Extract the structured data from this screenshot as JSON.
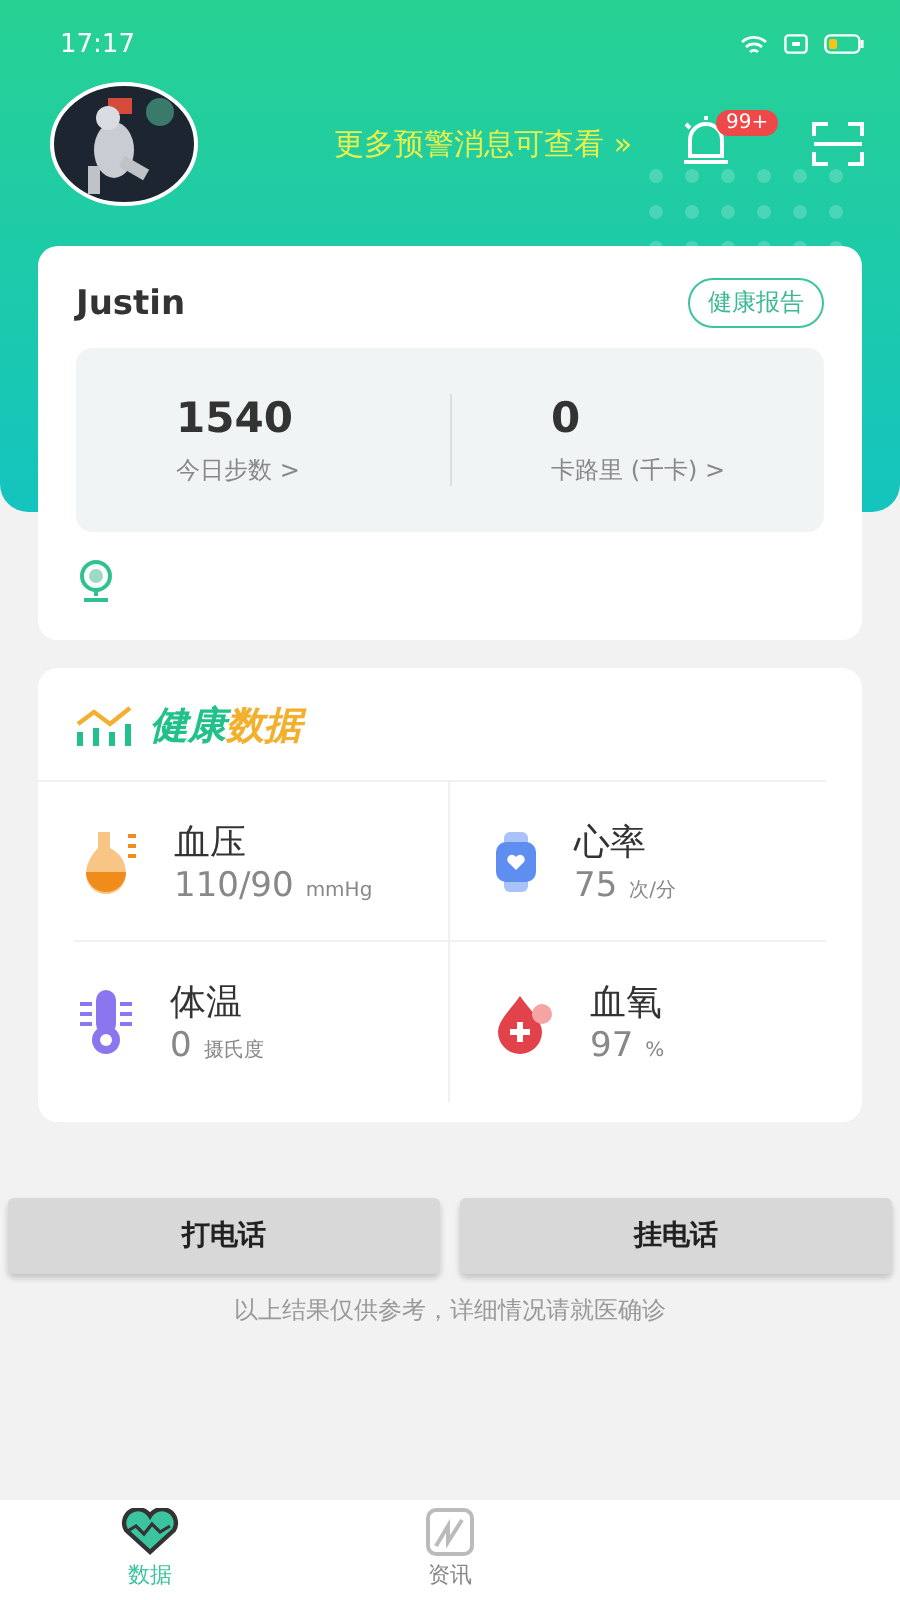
{
  "status_bar": {
    "time": "17:17"
  },
  "header": {
    "alert_link": "更多预警消息可查看 »",
    "badge": "99+"
  },
  "profile": {
    "name": "Justin",
    "report_button": "健康报告",
    "stats": [
      {
        "value": "1540",
        "label": "今日步数 >"
      },
      {
        "value": "0",
        "label": "卡路里 (千卡) >"
      }
    ]
  },
  "health": {
    "title_lead": "健康",
    "title_tail": "数据",
    "metrics": [
      {
        "kind": "pressure",
        "name": "血压",
        "value": "110/90",
        "unit": "mmHg"
      },
      {
        "kind": "heart",
        "name": "心率",
        "value": "75",
        "unit": "次/分"
      },
      {
        "kind": "temperature",
        "name": "体温",
        "value": "0",
        "unit": "摄氏度"
      },
      {
        "kind": "oxygen",
        "name": "血氧",
        "value": "97",
        "unit": "%"
      }
    ]
  },
  "buttons": [
    "打电话",
    "挂电话"
  ],
  "disclaimer": "以上结果仅供参考，详细情况请就医确诊",
  "tabs": [
    {
      "label": "数据",
      "kind": "heart",
      "selected": true
    },
    {
      "label": "资讯",
      "kind": "news",
      "selected": false
    }
  ]
}
